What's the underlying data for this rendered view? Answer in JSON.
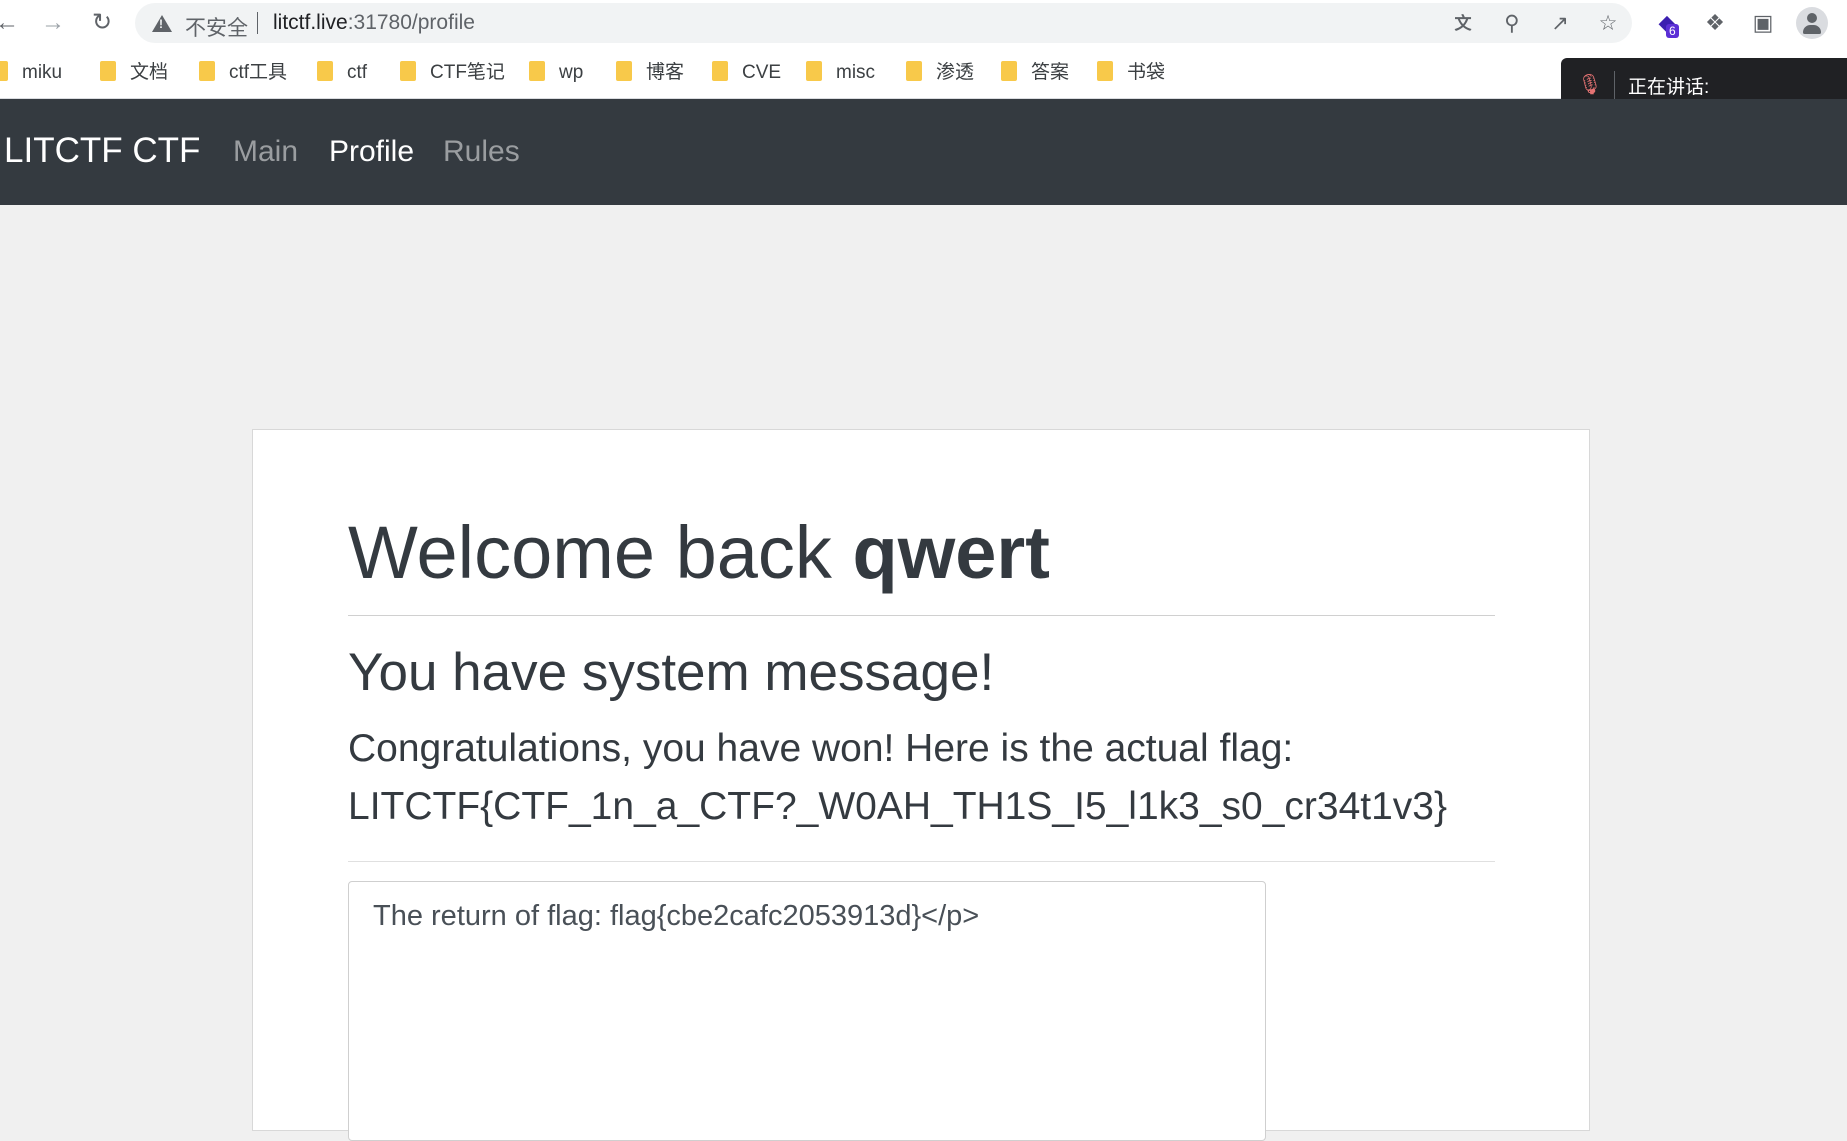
{
  "browser": {
    "insecure_label": "不安全",
    "url_host": "litctf.live",
    "url_path": ":31780/profile",
    "extension_badge": "6"
  },
  "bookmarks": [
    "miku",
    "文档",
    "ctf工具",
    "ctf",
    "CTF笔记",
    "wp",
    "博客",
    "CVE",
    "misc",
    "渗透",
    "答案",
    "书袋"
  ],
  "voice_popup": {
    "text": "正在讲话:"
  },
  "navbar": {
    "brand": "LITCTF CTF",
    "links": [
      "Main",
      "Profile",
      "Rules"
    ],
    "active": "Profile"
  },
  "profile": {
    "welcome_prefix": "Welcome back ",
    "username": "qwert",
    "system_heading": "You have system message!",
    "congrats_line": "Congratulations, you have won! Here is the actual flag:",
    "flag": "LITCTF{CTF_1n_a_CTF?_W0AH_TH1S_I5_l1k3_s0_cr34t1v3}",
    "message_box_text": "The return of flag: flag{cbe2cafc2053913d}</p>"
  },
  "colors": {
    "navbar_bg": "#343a40",
    "page_bg": "#f0f0f0",
    "folder": "#f8c94a"
  }
}
